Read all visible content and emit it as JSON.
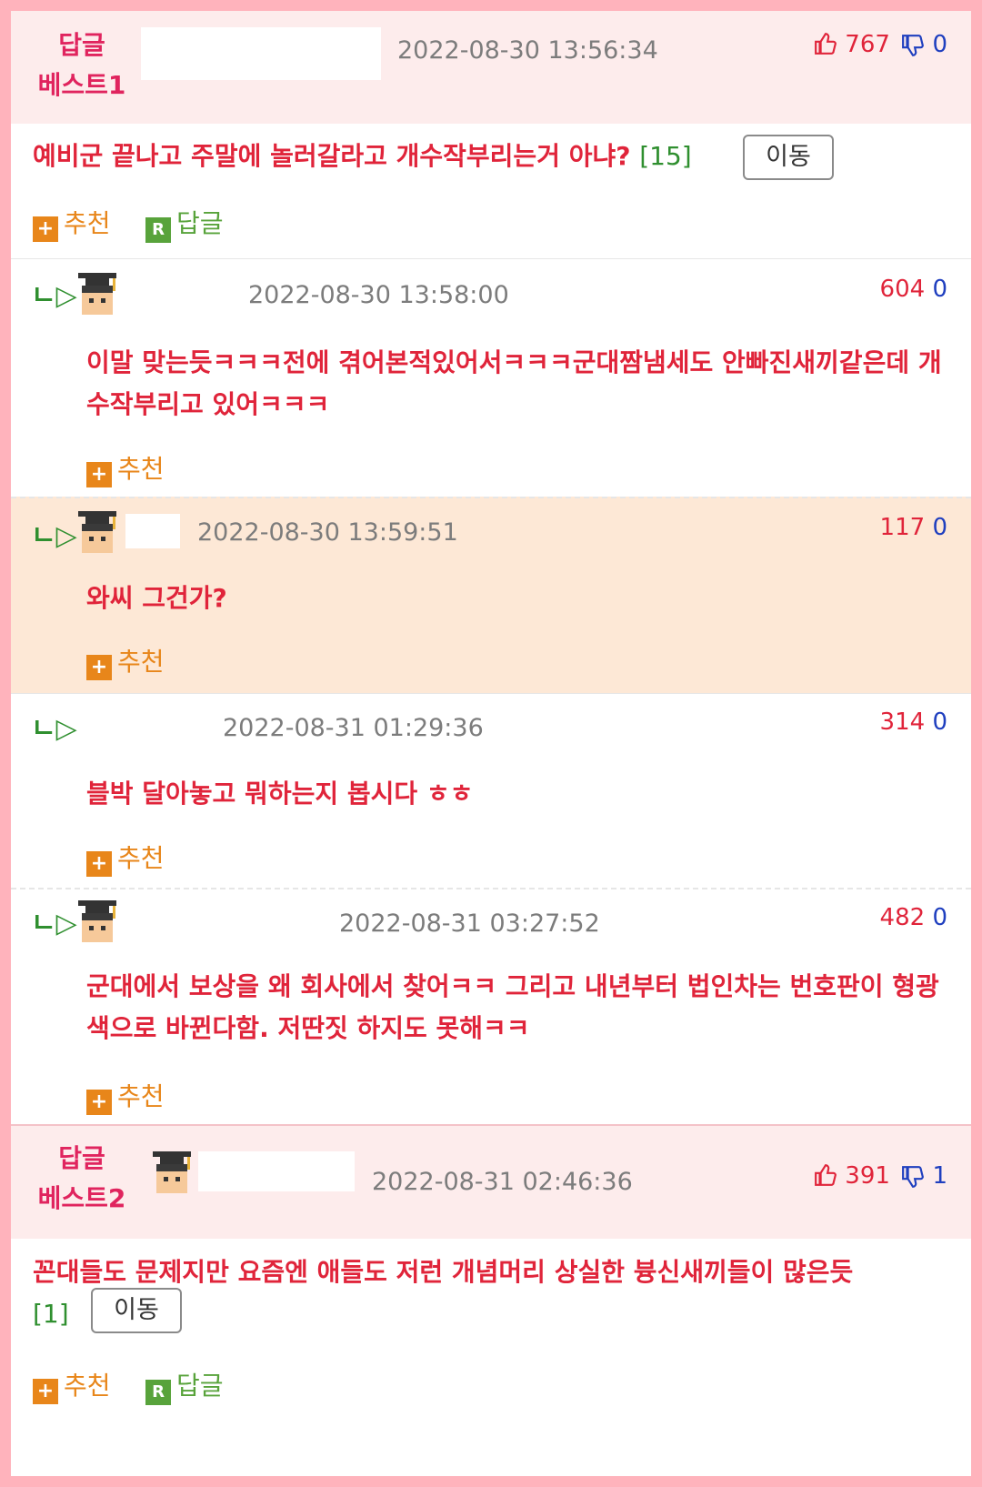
{
  "best1": {
    "label_line1": "답글",
    "label_line2": "베스트1",
    "timestamp": "2022-08-30 13:56:34",
    "up": "767",
    "down": "0",
    "text": "예비군 끝나고 주말에 놀러갈라고 개수작부리는거 아냐?",
    "ref": "[15]",
    "move_label": "이동",
    "recommend_label": "추천",
    "reply_label": "답글"
  },
  "replies": [
    {
      "timestamp": "2022-08-30 13:58:00",
      "up": "604",
      "down": "0",
      "text": "이말 맞는듯ㅋㅋㅋ전에 겪어본적있어서ㅋㅋㅋ군대짬냄세도 안빠진새끼같은데 개수작부리고 있어ㅋㅋㅋ",
      "recommend_label": "추천"
    },
    {
      "timestamp": "2022-08-30 13:59:51",
      "up": "117",
      "down": "0",
      "text": "와씨 그건가?",
      "recommend_label": "추천"
    },
    {
      "timestamp": "2022-08-31 01:29:36",
      "up": "314",
      "down": "0",
      "text": "블박 달아놓고 뭐하는지 봅시다 ㅎㅎ",
      "recommend_label": "추천"
    },
    {
      "timestamp": "2022-08-31 03:27:52",
      "up": "482",
      "down": "0",
      "text": "군대에서 보상을 왜 회사에서 찾어ㅋㅋ 그리고 내년부터 법인차는 번호판이 형광색으로 바뀐다함. 저딴짓 하지도 못해ㅋㅋ",
      "recommend_label": "추천"
    }
  ],
  "best2": {
    "label_line1": "답글",
    "label_line2": "베스트2",
    "timestamp": "2022-08-31 02:46:36",
    "up": "391",
    "down": "1",
    "text": "꼰대들도 문제지만 요즘엔 애들도 저런 개념머리 상실한 븅신새끼들이 많은듯",
    "ref": "[1]",
    "move_label": "이동",
    "recommend_label": "추천",
    "reply_label": "답글"
  },
  "icons": {
    "reply_arrow": "ㄴ▷",
    "thumb_up": "👍",
    "thumb_down": "👎"
  },
  "colors": {
    "border": "#ffb3bc",
    "best_header_bg": "#fdecec",
    "highlight_bg": "#fde8d6",
    "comment_text": "#e0243a",
    "recommend_orange": "#e8861a",
    "reply_green": "#58a33b"
  }
}
